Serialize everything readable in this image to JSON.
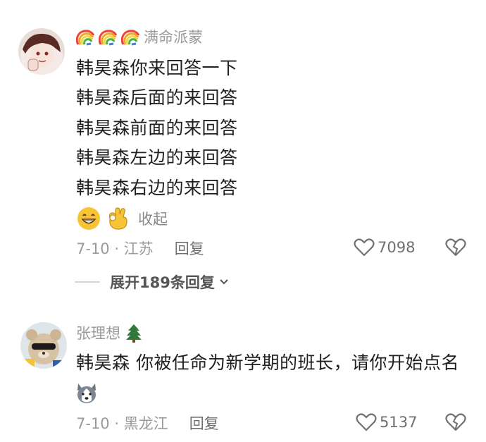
{
  "comment1": {
    "username": "满命派蒙",
    "lines": [
      "韩昊森你来回答一下",
      "韩昊森后面的来回答",
      "韩昊森前面的来回答",
      "韩昊森左边的来回答",
      "韩昊森右边的来回答"
    ],
    "collapse_label": "收起",
    "date_location": "7-10 · 江苏",
    "reply_label": "回复",
    "like_count": "7098"
  },
  "expand_replies_label": "展开189条回复",
  "comment2": {
    "username": "张理想",
    "text": "韩昊森 你被任命为新学期的班长，请你开始点名",
    "date_location": "7-10 · 黑龙江",
    "reply_label": "回复",
    "like_count": "5137"
  },
  "icons": {
    "rainbow": "rainbow-icon",
    "grin_emoji": "grinning-face-icon",
    "ok_hand": "ok-hand-icon",
    "husky": "husky-emoji-icon",
    "tree": "tree-icon",
    "heart": "heart-outline-icon",
    "dislike": "broken-heart-icon",
    "chevron": "chevron-down-icon"
  }
}
